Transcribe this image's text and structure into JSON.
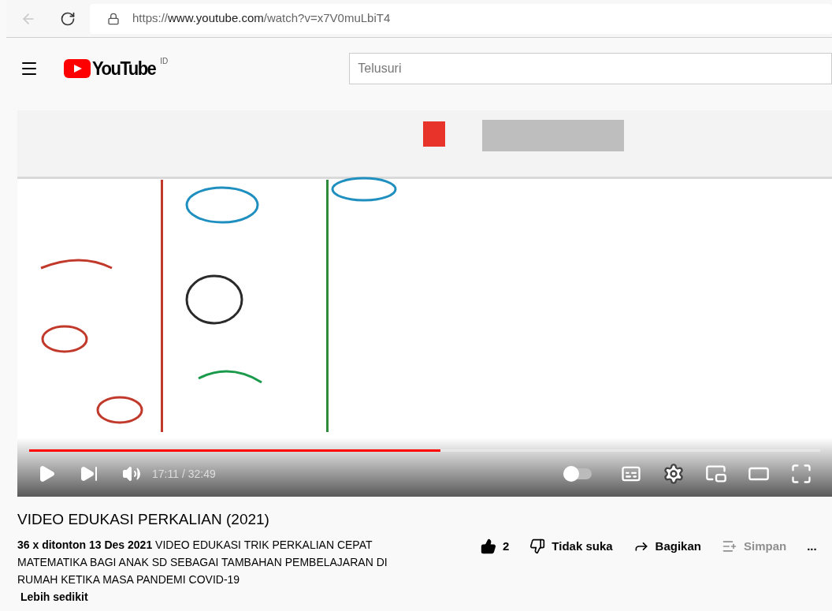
{
  "browser": {
    "back_disabled": true,
    "url_scheme": "https://",
    "url_host": "www.youtube.com",
    "url_path": "/watch?v=x7V0muLbiT4"
  },
  "header": {
    "logo": "YouTube",
    "region": "ID",
    "search": {
      "placeholder": "Telusuri"
    }
  },
  "player": {
    "progress": {
      "level": 0.52
    },
    "time": "17:11 / 32:49",
    "autoplay": {
      "on": false
    }
  },
  "video": {
    "title": "VIDEO EDUKASI PERKALIAN (2021)",
    "views": "36 x ditonton",
    "date": "13 Des 2021",
    "description": "VIDEO EDUKASI TRIK PERKALIAN CEPAT MATEMATIKA BAGI ANAK SD SEBAGAI TAMBAHAN PEMBELAJARAN DI RUMAH KETIKA MASA PANDEMI COVID-19",
    "less": "Lebih sedikit"
  },
  "actions": [
    {
      "kind": "like",
      "label": "2",
      "filled": true,
      "disabled": false
    },
    {
      "kind": "dislike",
      "label": "Tidak suka",
      "filled": false,
      "disabled": false
    },
    {
      "kind": "share",
      "label": "Bagikan",
      "disabled": false
    },
    {
      "kind": "save",
      "label": "Simpan",
      "disabled": true
    },
    {
      "kind": "more",
      "label": "...",
      "disabled": false
    }
  ]
}
